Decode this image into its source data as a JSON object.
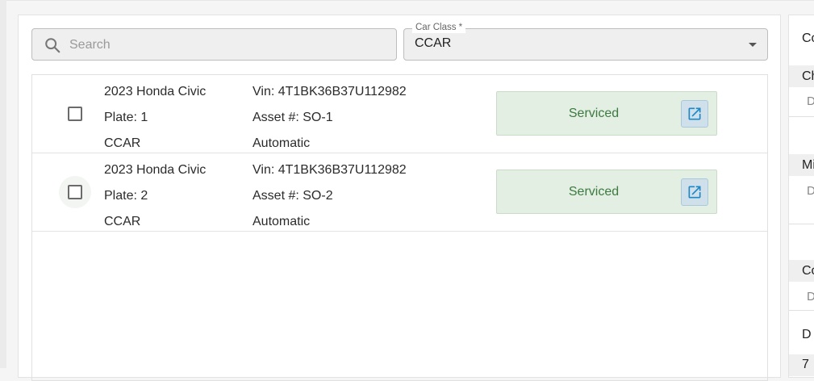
{
  "search": {
    "placeholder": "Search",
    "value": ""
  },
  "car_class": {
    "label": "Car Class *",
    "value": "CCAR"
  },
  "vehicles": [
    {
      "name": "2023 Honda Civic",
      "plate": "Plate: 1",
      "class": "CCAR",
      "vin": "Vin: 4T1BK36B37U112982",
      "asset": "Asset #: SO-1",
      "transmission": "Automatic",
      "status": "Serviced"
    },
    {
      "name": "2023 Honda Civic",
      "plate": "Plate: 2",
      "class": "CCAR",
      "vin": "Vin: 4T1BK36B37U112982",
      "asset": "Asset #: SO-2",
      "transmission": "Automatic",
      "status": "Serviced"
    }
  ],
  "right_panel": {
    "header": "Co",
    "section1": "Ch",
    "section1_sub": "D",
    "section2": "Mi",
    "section2_sub": "D",
    "section3": "Co",
    "section3_sub": "D",
    "section4": "D",
    "section5": "7"
  },
  "colors": {
    "serviced_bg": "#e3efe3",
    "serviced_text": "#3c7a40",
    "link_icon": "#1e88c7"
  }
}
